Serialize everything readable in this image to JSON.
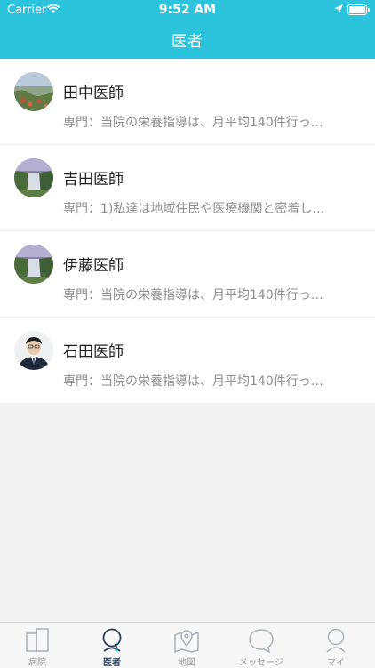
{
  "status_bar": {
    "carrier": "Carrier",
    "time": "9:52 AM"
  },
  "header": {
    "title": "医者"
  },
  "doctors": [
    {
      "name": "田中医師",
      "description": "専門：当院の栄養指導は、月平均140件行っ…",
      "avatar": "landscape-avatar"
    },
    {
      "name": "吉田医師",
      "description": "専門：1)私達は地域住民や医療機関と密着し…",
      "avatar": "waterfall-avatar"
    },
    {
      "name": "伊藤医師",
      "description": "専門：当院の栄養指導は、月平均140件行っ…",
      "avatar": "waterfall-avatar"
    },
    {
      "name": "石田医師",
      "description": "専門：当院の栄養指導は、月平均140件行っ…",
      "avatar": "person-avatar"
    }
  ],
  "tabbar": {
    "tabs": [
      {
        "label": "病院",
        "icon": "hospital-icon",
        "active": false
      },
      {
        "label": "医者",
        "icon": "doctor-icon",
        "active": true
      },
      {
        "label": "地図",
        "icon": "map-icon",
        "active": false
      },
      {
        "label": "メッセージ",
        "icon": "message-icon",
        "active": false
      },
      {
        "label": "マイ",
        "icon": "profile-icon",
        "active": false
      }
    ]
  },
  "colors": {
    "header": "#2cc3dc",
    "active_tab": "#2d3e5a",
    "inactive_tab": "#9a9a9a"
  }
}
